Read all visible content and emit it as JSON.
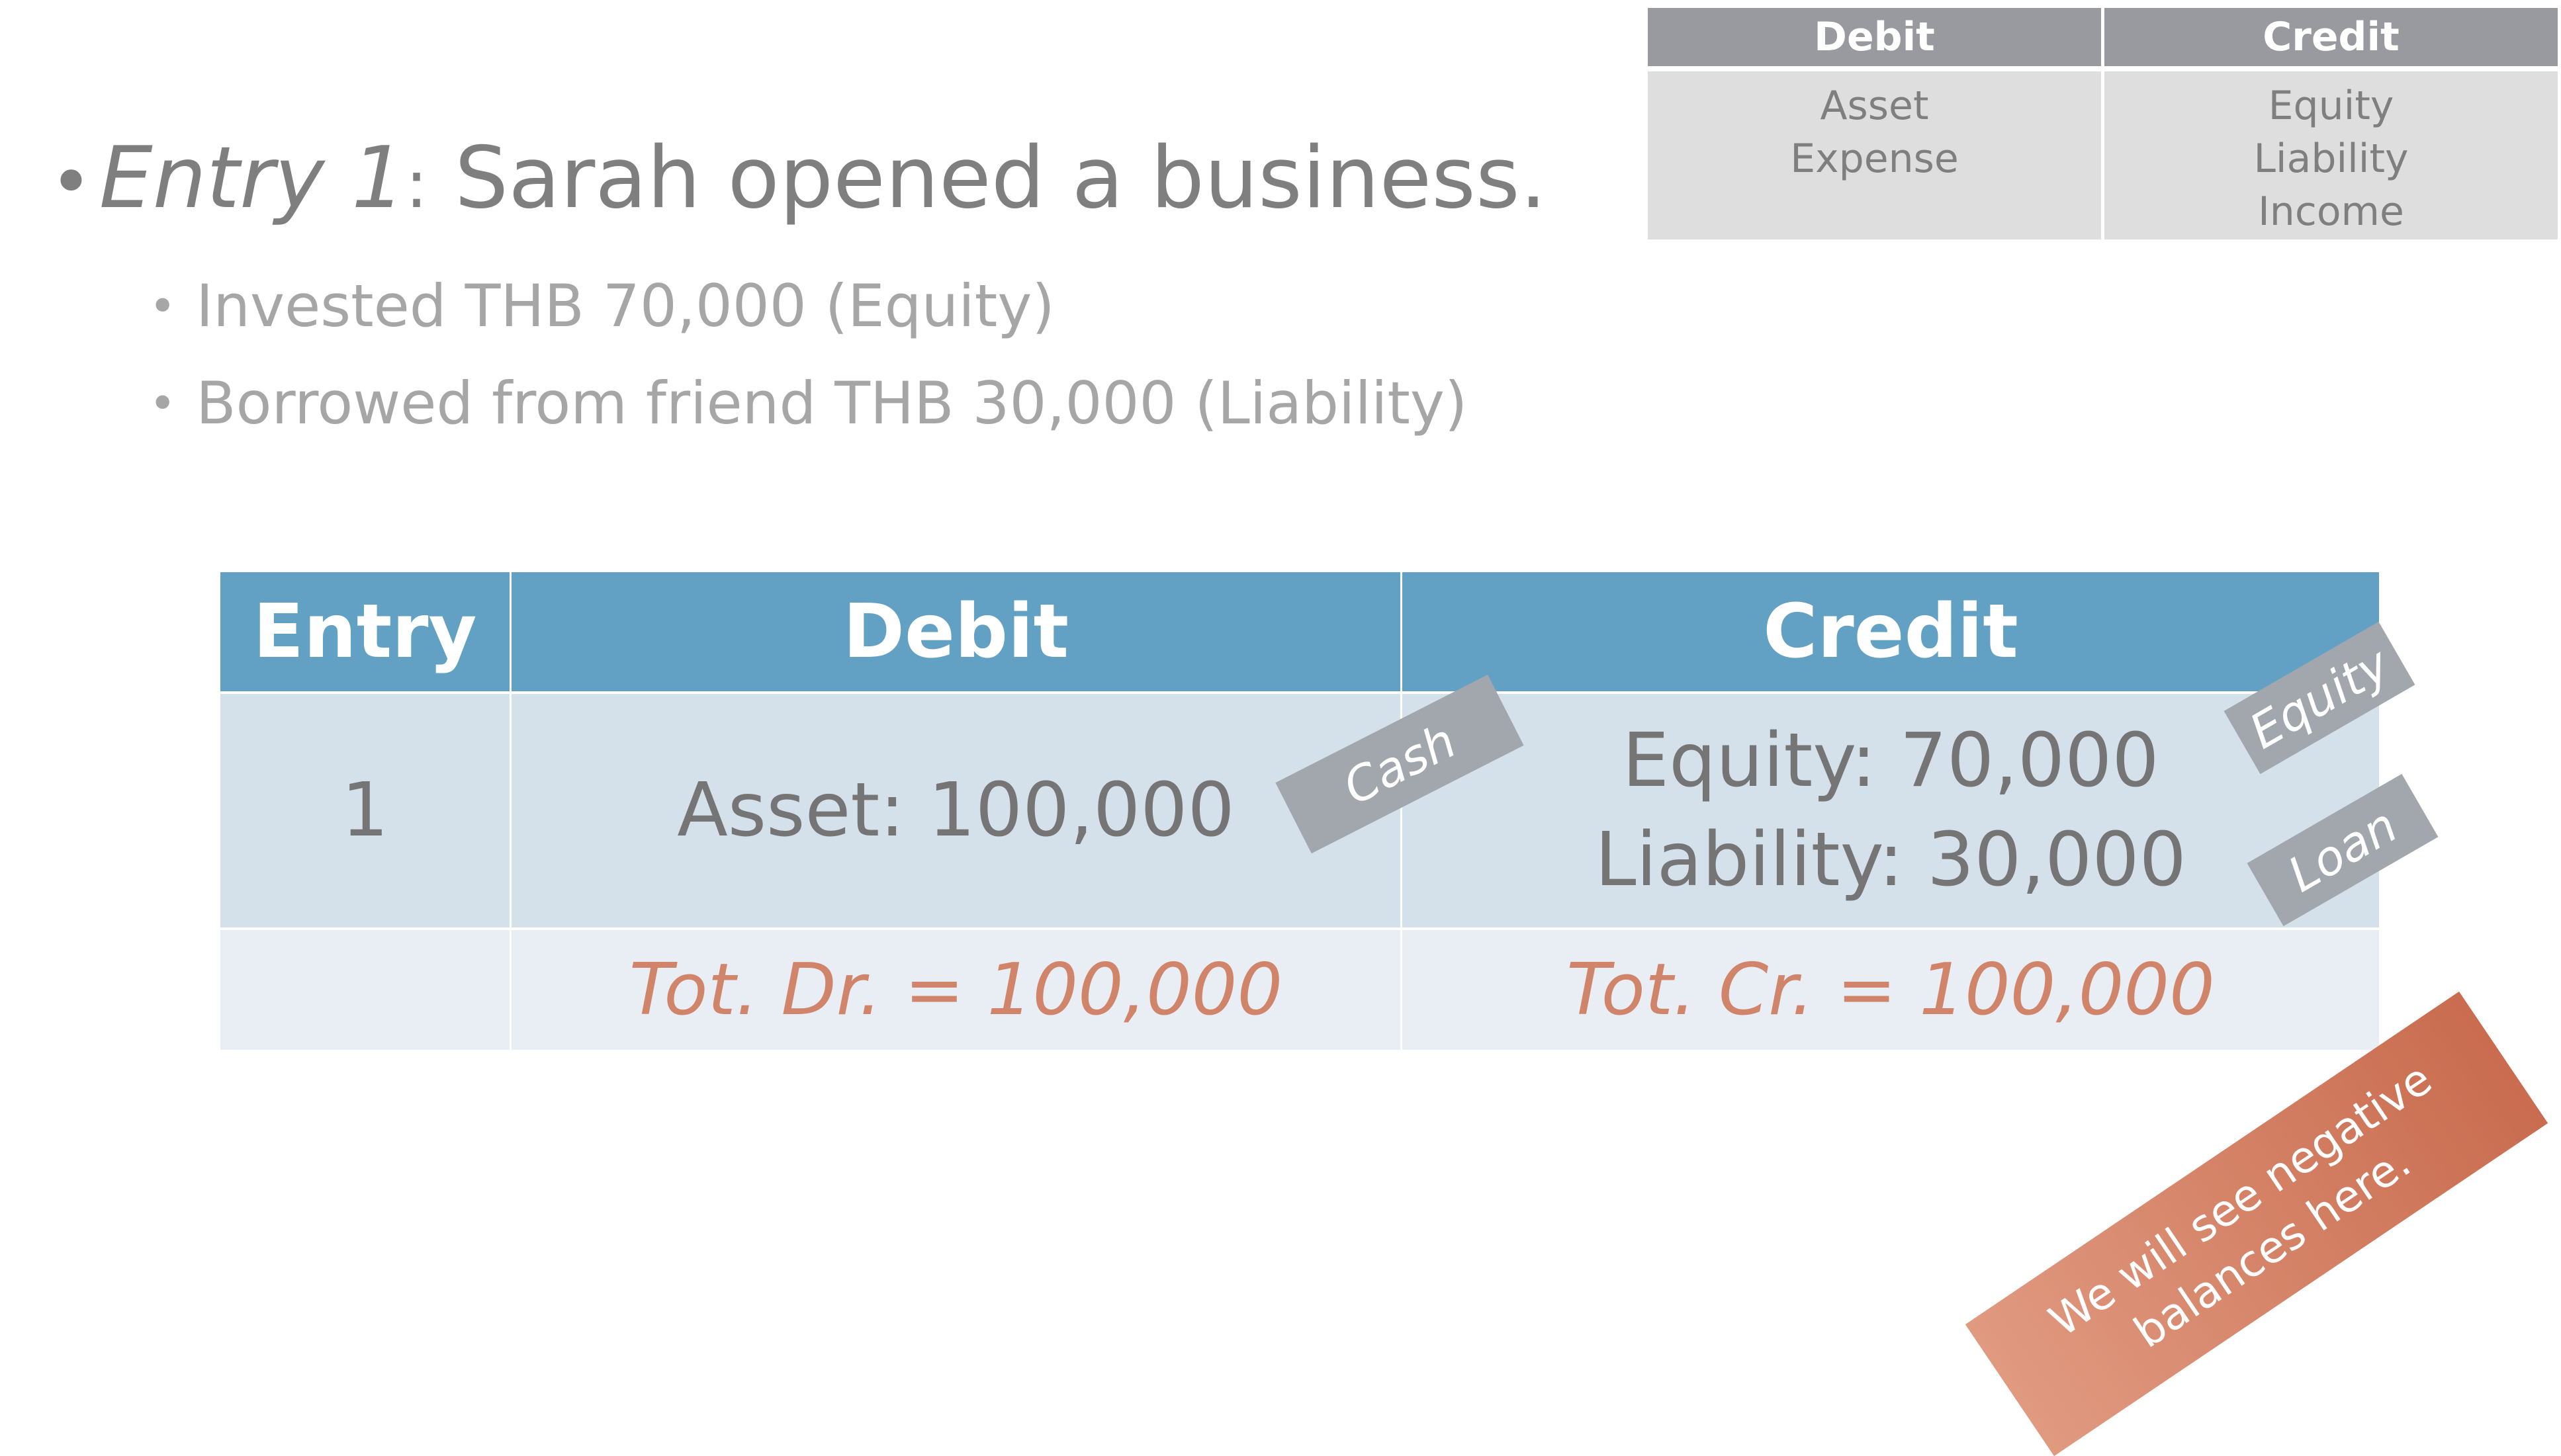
{
  "reference_table": {
    "debit_header": "Debit",
    "credit_header": "Credit",
    "debit_items": [
      "Asset",
      "Expense"
    ],
    "credit_items": [
      "Equity",
      "Liability",
      "Income"
    ]
  },
  "bullets": {
    "main_italic": "Entry 1",
    "main_colon": ":",
    "main_rest": " Sarah opened a business.",
    "sub": [
      "Invested THB 70,000 (Equity)",
      "Borrowed from friend THB 30,000 (Liability)"
    ]
  },
  "journal_table": {
    "headers": {
      "entry": "Entry",
      "debit": "Debit",
      "credit": "Credit"
    },
    "row": {
      "entry": "1",
      "debit": "Asset: 100,000",
      "credit_line1": "Equity: 70,000",
      "credit_line2": "Liability: 30,000"
    },
    "totals": {
      "debit": "Tot. Dr. = 100,000",
      "credit": "Tot. Cr. = 100,000"
    }
  },
  "tags": {
    "cash": "Cash",
    "equity": "Equity",
    "loan": "Loan"
  },
  "note": {
    "line1": "We will see negative",
    "line2": "balances here."
  },
  "colors": {
    "header_blue": "#62a1c3",
    "row_light_blue": "#d4e1ea",
    "total_row": "#e9eef5",
    "total_text": "#d0856a",
    "tag_gray": "#a2a7ad",
    "note_orange": "#c96c4f"
  }
}
